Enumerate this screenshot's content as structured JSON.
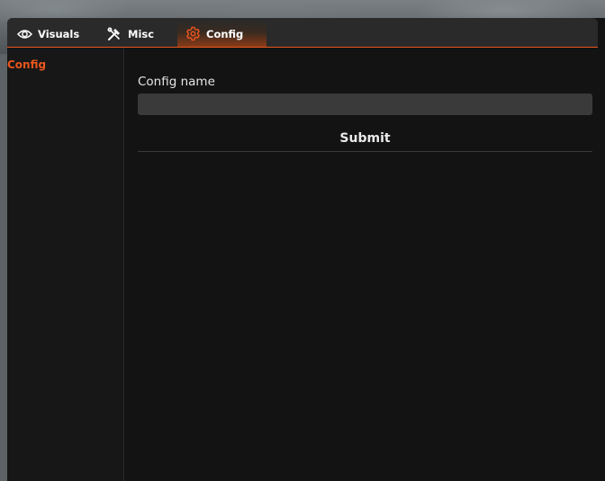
{
  "tabs": [
    {
      "label": "Visuals",
      "icon": "eye-icon",
      "active": false
    },
    {
      "label": "Misc",
      "icon": "tools-icon",
      "active": false
    },
    {
      "label": "Config",
      "icon": "gear-icon",
      "active": true
    }
  ],
  "sidebar": {
    "items": [
      {
        "label": "Config",
        "active": true
      }
    ]
  },
  "form": {
    "config_name_label": "Config name",
    "config_name_value": "",
    "submit_label": "Submit"
  },
  "colors": {
    "accent": "#e8561d",
    "panel": "#131313",
    "sidebar": "#171717",
    "tabbar": "#2a2a2a",
    "input": "#3a3a3a"
  }
}
